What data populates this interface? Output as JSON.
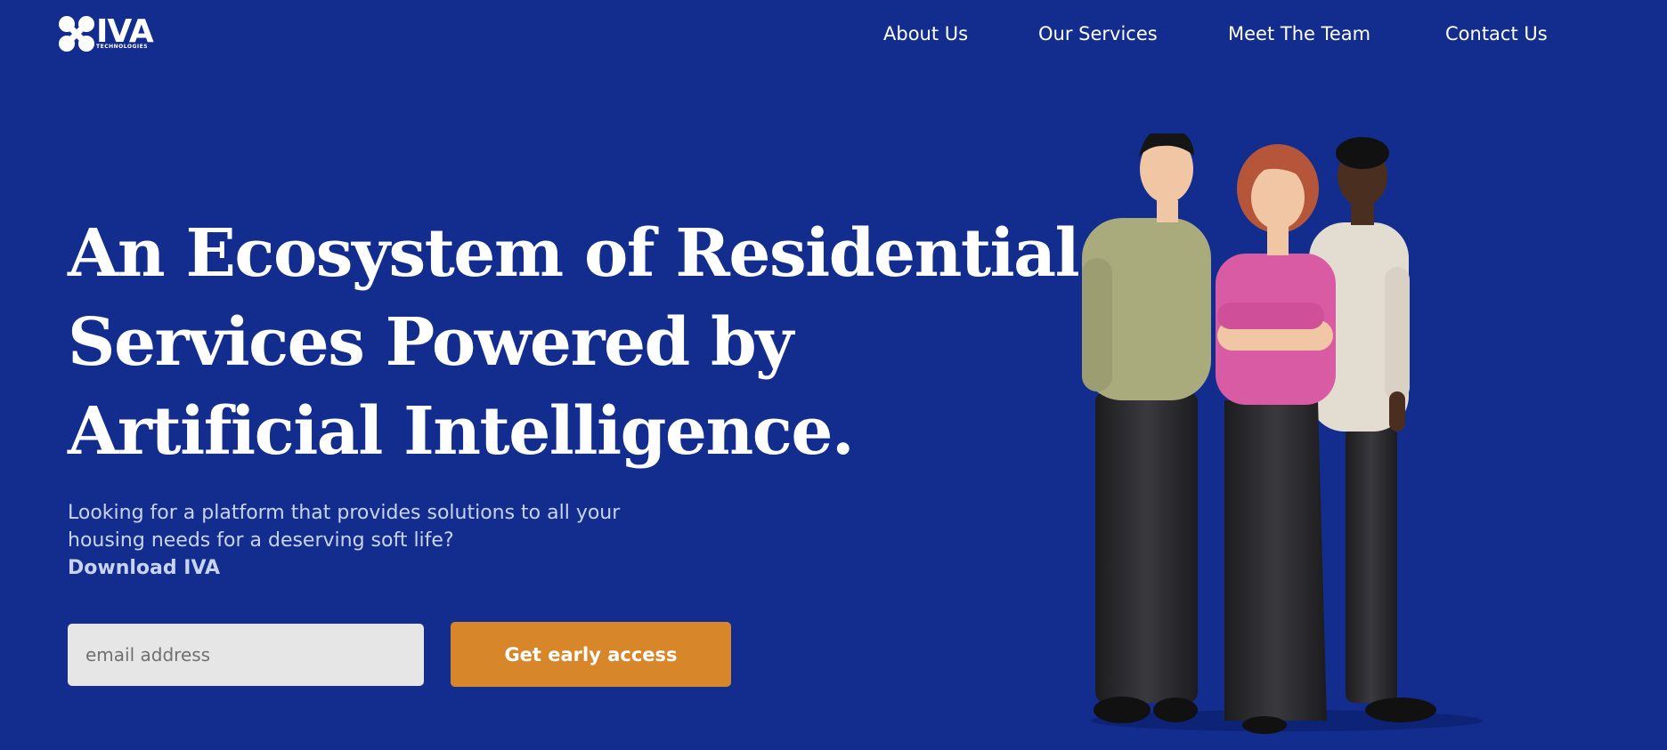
{
  "brand": {
    "name": "IVA",
    "tagline": "TECHNOLOGIES",
    "logo_icon": "four-dots-icon"
  },
  "nav": {
    "items": [
      {
        "label": "About Us"
      },
      {
        "label": "Our Services"
      },
      {
        "label": "Meet The Team"
      },
      {
        "label": "Contact Us"
      }
    ]
  },
  "hero": {
    "headline": "An Ecosystem of Residential Services Powered by Artificial Intelligence.",
    "subtext": "Looking for a platform that provides solutions to all your housing needs for a deserving soft life?",
    "subtext_strong": "Download IVA",
    "email_placeholder": "email address",
    "cta_label": "Get early access"
  },
  "illustration": {
    "subject": "three-people-illustration"
  },
  "colors": {
    "background": "#132d8e",
    "accent": "#d8862a",
    "input_bg": "#e6e6e7",
    "subtext": "#c9d4f5"
  }
}
